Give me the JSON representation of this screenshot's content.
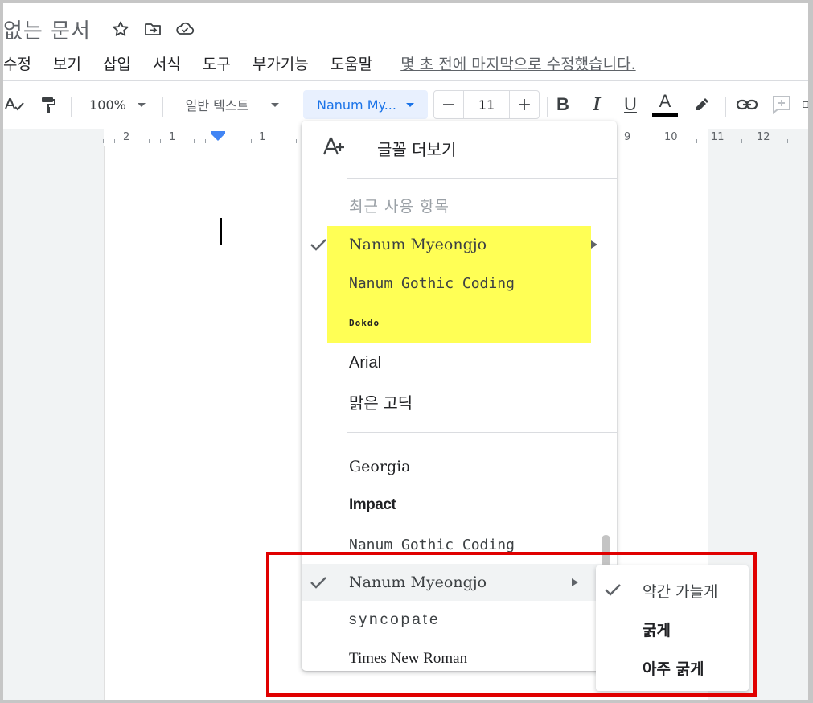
{
  "header": {
    "doc_title": "없는 문서",
    "icons": [
      "star-icon",
      "move-to-folder-icon",
      "cloud-saved-icon"
    ]
  },
  "menu": {
    "items": [
      "수정",
      "보기",
      "삽입",
      "서식",
      "도구",
      "부가기능",
      "도움말"
    ],
    "last_edit": "몇 초 전에 마지막으로 수정했습니다."
  },
  "toolbar": {
    "zoom": "100%",
    "paragraph_style": "일반 텍스트",
    "font": "Nanum My...",
    "font_size": "11",
    "decrease": "−",
    "increase": "+",
    "bold": "B",
    "italic": "I",
    "underline": "U",
    "text_color": "A",
    "text_color_value": "#000000"
  },
  "ruler": {
    "labels": [
      "2",
      "1",
      "1",
      "9",
      "10",
      "11",
      "12"
    ]
  },
  "font_menu": {
    "more_fonts": "글꼴 더보기",
    "recent_header": "최근 사용 항목",
    "recent": [
      "Nanum Myeongjo",
      "Nanum Gothic Coding",
      "Dokdo"
    ],
    "highlight_color": "#ffff55",
    "fonts_a": [
      "Arial",
      "맑은 고딕"
    ],
    "fonts_b": [
      "Georgia",
      "Impact",
      "Nanum Gothic Coding",
      "Nanum Myeongjo",
      "Syncopate",
      "Times New Roman"
    ]
  },
  "weight_submenu": {
    "items": [
      "약간 가늘게",
      "굵게",
      "아주 굵게"
    ],
    "selected": "약간 가늘게"
  },
  "annotation_color": "#e00000"
}
